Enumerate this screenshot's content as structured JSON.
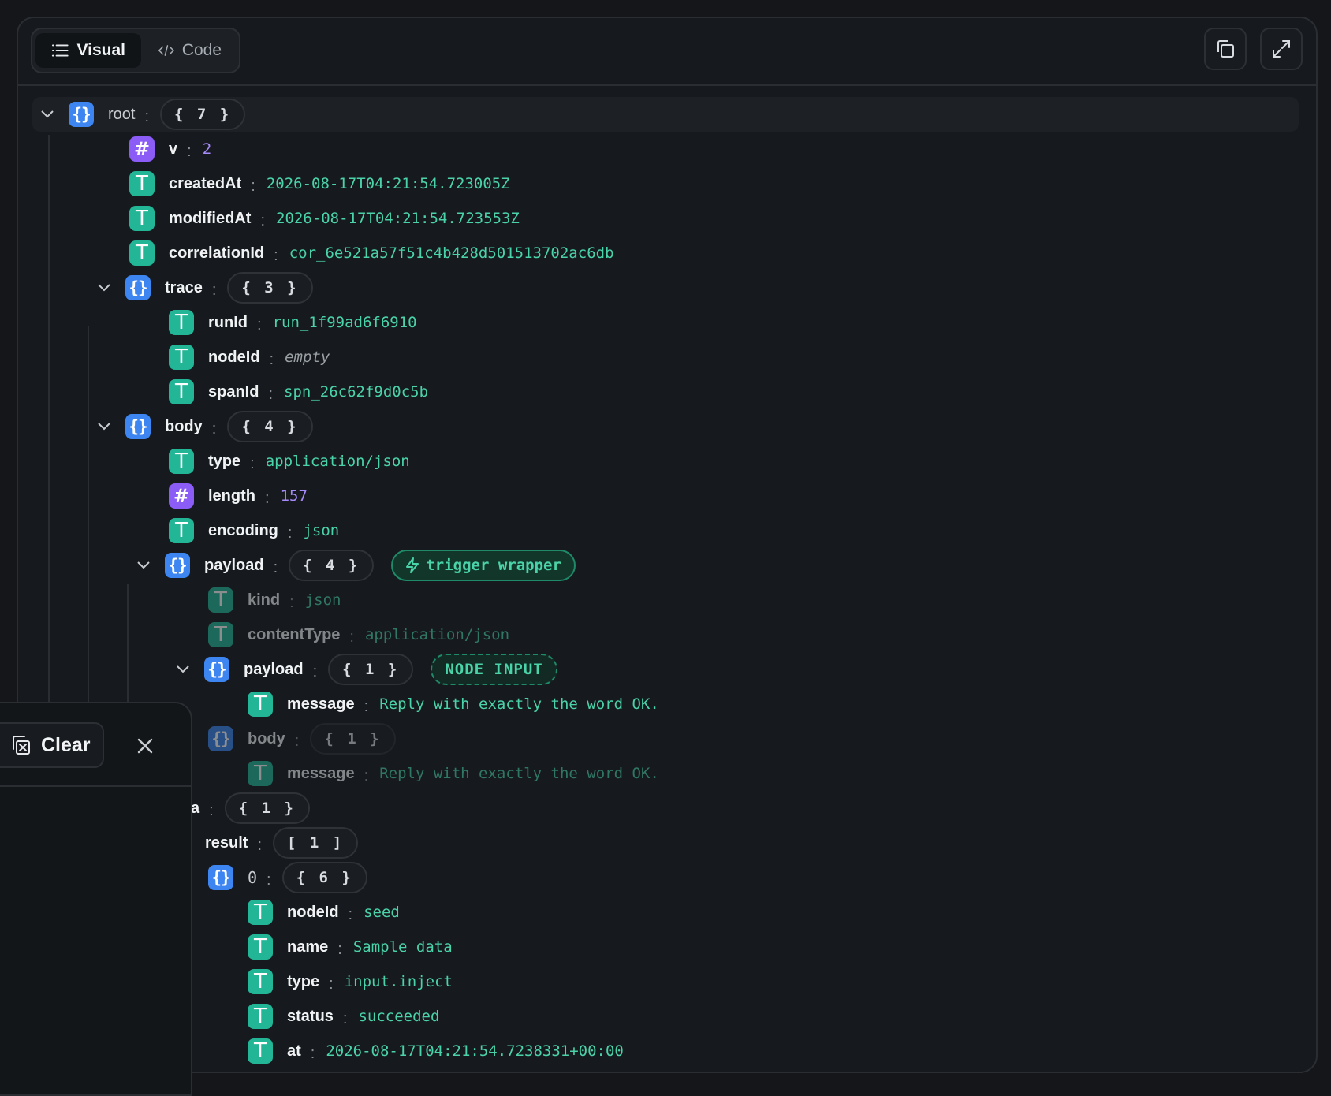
{
  "toolbar": {
    "tab_visual": "Visual",
    "tab_code": "Code",
    "copy_icon": "copy-icon",
    "expand_icon": "expand-icon"
  },
  "tree": {
    "root": {
      "key": "root",
      "count": "{ 7 }"
    },
    "v": {
      "key": "v",
      "value": "2"
    },
    "createdAt": {
      "key": "createdAt",
      "value": "2026-08-17T04:21:54.723005Z"
    },
    "modifiedAt": {
      "key": "modifiedAt",
      "value": "2026-08-17T04:21:54.723553Z"
    },
    "correlationId": {
      "key": "correlationId",
      "value": "cor_6e521a57f51c4b428d501513702ac6db"
    },
    "trace": {
      "key": "trace",
      "count": "{ 3 }",
      "runId": {
        "key": "runId",
        "value": "run_1f99ad6f6910"
      },
      "nodeId": {
        "key": "nodeId",
        "value": "empty"
      },
      "spanId": {
        "key": "spanId",
        "value": "spn_26c62f9d0c5b"
      }
    },
    "body": {
      "key": "body",
      "count": "{ 4 }",
      "type": {
        "key": "type",
        "value": "application/json"
      },
      "length": {
        "key": "length",
        "value": "157"
      },
      "encoding": {
        "key": "encoding",
        "value": "json"
      },
      "payload": {
        "key": "payload",
        "count": "{ 4 }",
        "tag": "trigger wrapper",
        "kind": {
          "key": "kind",
          "value": "json"
        },
        "contentType": {
          "key": "contentType",
          "value": "application/json"
        },
        "inner_payload": {
          "key": "payload",
          "count": "{ 1 }",
          "tag": "NODE INPUT",
          "message": {
            "key": "message",
            "value": "Reply with exactly the word OK."
          }
        },
        "inner_body": {
          "key": "body",
          "count": "{ 1 }",
          "message": {
            "key": "message",
            "value": "Reply with exactly the word OK."
          }
        }
      }
    },
    "partial_a": {
      "key": "a",
      "count": "{ 1 }"
    },
    "result": {
      "key": "result",
      "count": "[ 1 ]"
    },
    "item0": {
      "key": "0",
      "count": "{ 6 }",
      "nodeId": {
        "key": "nodeId",
        "value": "seed"
      },
      "name": {
        "key": "name",
        "value": "Sample data"
      },
      "type": {
        "key": "type",
        "value": "input.inject"
      },
      "status": {
        "key": "status",
        "value": "succeeded"
      },
      "at": {
        "key": "at",
        "value": "2026-08-17T04:21:54.7238331+00:00"
      }
    }
  },
  "overlay": {
    "clear_label": "Clear"
  },
  "colors": {
    "string": "#22b596",
    "number": "#8b5cf6",
    "object": "#3d85f0",
    "value_text": "#4ad3a8"
  }
}
